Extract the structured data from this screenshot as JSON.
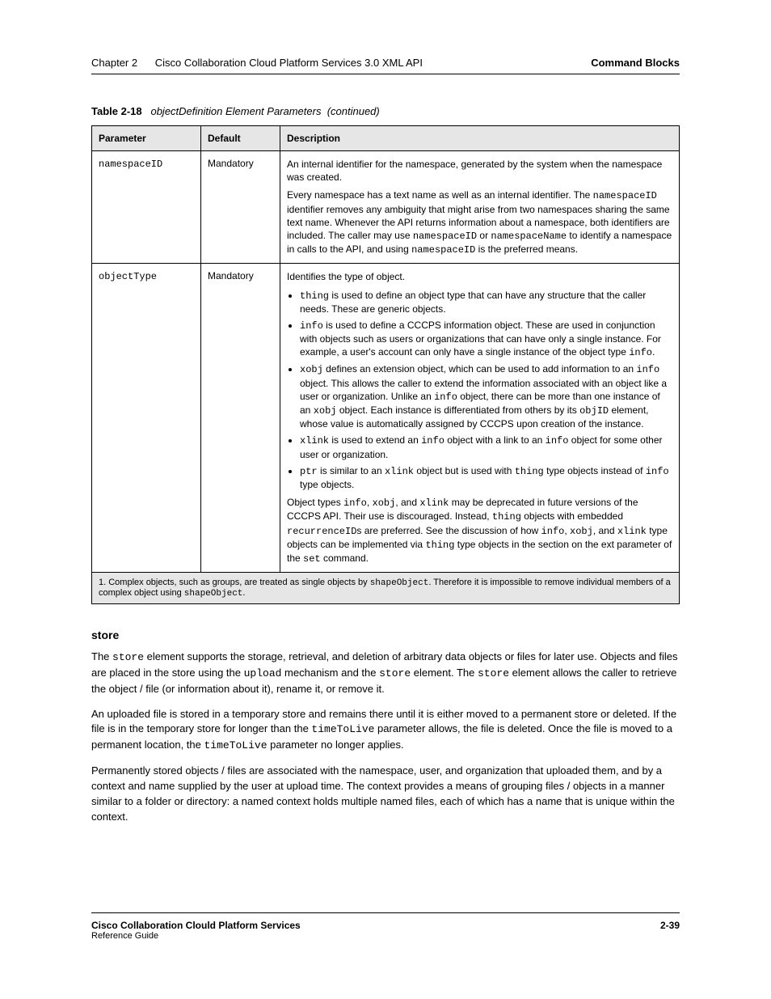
{
  "header": {
    "chapter_no": "Chapter 2",
    "chapter_title": "Cisco Collaboration Cloud Platform Services 3.0 XML API",
    "section": "Command Blocks"
  },
  "table_caption": {
    "label": "Table 2-18",
    "title": "objectDefinition Element Parameters",
    "continued": "(continued)"
  },
  "table": {
    "headers": [
      "Parameter",
      "Default",
      "Description"
    ],
    "rows": [
      {
        "param": "namespaceID",
        "default": "Mandatory",
        "desc_paragraphs": [
          "An internal identifier for the namespace, generated by the system when the namespace was created.",
          "Every namespace has a text name as well as an internal identifier. The <code>namespaceID</code> identifier removes any ambiguity that might arise from two namespaces sharing the same text name. Whenever the API returns information about a namespace, both identifiers are included. The caller may use <code>namespaceID</code> or <code>namespaceName</code> to identify a namespace in calls to the API, and using <code>namespaceID</code> is the preferred means."
        ]
      },
      {
        "param": "objectType",
        "default": "Mandatory",
        "desc_paragraphs": [
          "Identifies the type of object."
        ],
        "desc_list": [
          "<code>thing</code> is used to define an object type that can have any structure that the caller needs. These are generic objects.",
          "<code>info</code> is used to define a CCCPS information object. These are used in conjunction with objects such as users or organizations that can have only a single instance. For example, a user's account can only have a single instance of the object type <code>info</code>.",
          "<code>xobj</code> defines an extension object, which can be used to add information to an <code>info</code> object. This allows the caller to extend the information associated with an object like a user or organization. Unlike an <code>info</code> object, there can be more than one instance of an <code>xobj</code> object. Each instance is differentiated from others by its <code>objID</code> element, whose value is automatically assigned by CCCPS upon creation of the instance.",
          "<code>xlink</code> is used to extend an <code>info</code> object with a link to an <code>info</code> object for some other user or organization.",
          "<code>ptr</code> is similar to an <code>xlink</code> object but is used with <code>thing</code> type objects instead of <code>info</code> type objects."
        ],
        "desc_paragraphs_after": [
          "Object types <code>info</code>, <code>xobj</code>, and <code>xlink</code> may be deprecated in future versions of the CCCPS API. Their use is discouraged. Instead, <code>thing</code> objects with embedded <code>recurrenceID</code>s are preferred. See the discussion of how <code>info</code>, <code>xobj</code>, and <code>xlink</code> type objects can be implemented via <code>thing</code> type objects in the section on the ext parameter of the <code>set</code> command."
        ]
      }
    ],
    "footer_note": "1. Complex objects, such as groups, are treated as single objects by <code>shapeObject</code>. Therefore it is impossible to remove individual members of a complex object using <code>shapeObject</code>."
  },
  "body_heading": "store",
  "body_paragraphs": [
    "The <code>store</code> element supports the storage, retrieval, and deletion of arbitrary data objects or files for later use. Objects and files are placed in the store using the <code>upload</code> mechanism and the <code>store</code> element. The <code>store</code> element allows the caller to retrieve the object / file (or information about it), rename it, or remove it.",
    "An uploaded file is stored in a temporary store and remains there until it is either moved to a permanent store or deleted. If the file is in the temporary store for longer than the <code>timeToLive</code> parameter allows, the file is deleted. Once the file is moved to a permanent location, the <code>timeToLive</code> parameter no longer applies.",
    "Permanently stored objects / files are associated with the namespace, user, and organization that uploaded them, and by a context and name supplied by the user at upload time. The context provides a means of grouping files / objects in a manner similar to a folder or directory: a named context holds multiple named files, each of which has a name that is unique within the context."
  ],
  "footer": {
    "left": "2-39",
    "right_line1": "Cisco Collaboration Clould Platform Services",
    "right_line2": "Reference Guide"
  }
}
